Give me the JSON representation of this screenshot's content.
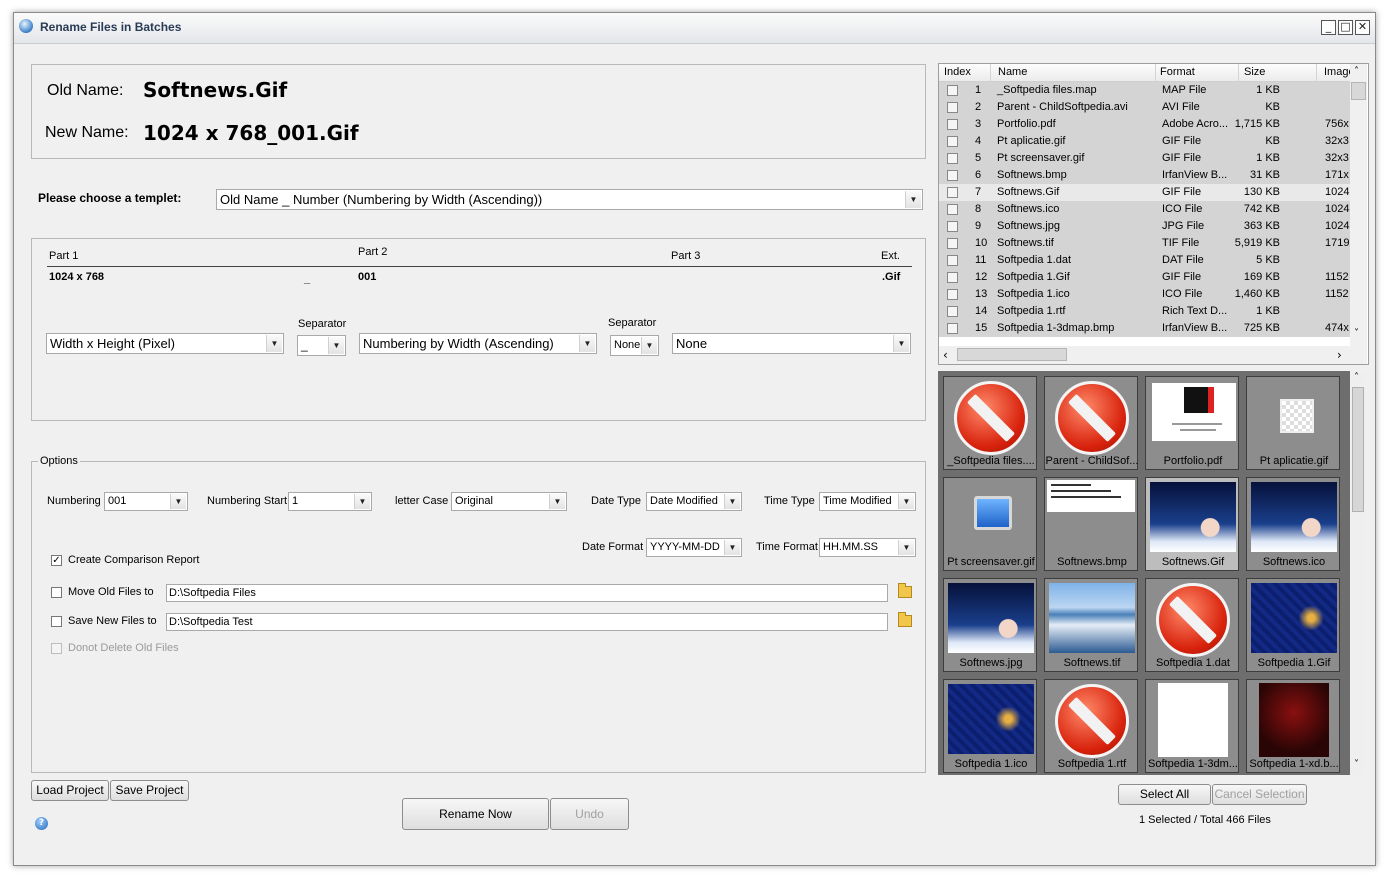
{
  "window": {
    "title": "Rename Files in Batches",
    "minimize": "_",
    "maximize": "□",
    "close": "✕"
  },
  "names": {
    "old_label": "Old Name:",
    "old_value": "Softnews.Gif",
    "new_label": "New Name:",
    "new_value": "1024 x 768_001.Gif"
  },
  "template": {
    "label": "Please choose a templet:",
    "value": "Old Name _ Number (Numbering by Width (Ascending))"
  },
  "parts": {
    "part1_label": "Part 1",
    "part2_label": "Part 2",
    "part3_label": "Part 3",
    "ext_label": "Ext.",
    "part1_value": "1024 x 768",
    "sep1_value": "_",
    "part2_value": "001",
    "ext_value": ".Gif",
    "separator_label_1": "Separator",
    "separator_label_2": "Separator",
    "combo1": "Width x Height (Pixel)",
    "combo_sep1": "_",
    "combo2": "Numbering by Width (Ascending)",
    "combo_sep2": "None",
    "combo3": "None"
  },
  "options": {
    "title": "Options",
    "numbering_label": "Numbering",
    "numbering_value": "001",
    "numbering_start_label": "Numbering Start",
    "numbering_start_value": "1",
    "letter_case_label": "letter Case",
    "letter_case_value": "Original",
    "date_type_label": "Date Type",
    "date_type_value": "Date Modified",
    "time_type_label": "Time Type",
    "time_type_value": "Time Modified",
    "date_format_label": "Date Format",
    "date_format_value": "YYYY-MM-DD",
    "time_format_label": "Time Format",
    "time_format_value": "HH.MM.SS",
    "create_report_label": "Create Comparison Report",
    "create_report_checked": true,
    "move_old_label": "Move Old Files to",
    "move_old_path": "D:\\Softpedia Files",
    "save_new_label": "Save New Files to",
    "save_new_path": "D:\\Softpedia Test",
    "donot_delete_label": "Donot Delete Old Files"
  },
  "buttons": {
    "load_project": "Load Project",
    "save_project": "Save Project",
    "rename_now": "Rename Now",
    "undo": "Undo",
    "select_all": "Select All",
    "cancel_selection": "Cancel Selection"
  },
  "status": "1 Selected / Total 466 Files",
  "filelist": {
    "columns": [
      "Index",
      "Name",
      "Format",
      "Size",
      "Image"
    ],
    "rows": [
      {
        "index": "1",
        "name": "_Softpedia files.map",
        "format": "MAP File",
        "size": "1 KB",
        "image": ""
      },
      {
        "index": "2",
        "name": "Parent - ChildSoftpedia.avi",
        "format": "AVI File",
        "size": "KB",
        "image": ""
      },
      {
        "index": "3",
        "name": "Portfolio.pdf",
        "format": "Adobe Acro...",
        "size": "1,715 KB",
        "image": "756x"
      },
      {
        "index": "4",
        "name": "Pt aplicatie.gif",
        "format": "GIF File",
        "size": "KB",
        "image": "32x3"
      },
      {
        "index": "5",
        "name": "Pt screensaver.gif",
        "format": "GIF File",
        "size": "1 KB",
        "image": "32x3"
      },
      {
        "index": "6",
        "name": "Softnews.bmp",
        "format": "IrfanView B...",
        "size": "31 KB",
        "image": "171x"
      },
      {
        "index": "7",
        "name": "Softnews.Gif",
        "format": "GIF File",
        "size": "130 KB",
        "image": "1024"
      },
      {
        "index": "8",
        "name": "Softnews.ico",
        "format": "ICO File",
        "size": "742 KB",
        "image": "1024"
      },
      {
        "index": "9",
        "name": "Softnews.jpg",
        "format": "JPG File",
        "size": "363 KB",
        "image": "1024"
      },
      {
        "index": "10",
        "name": "Softnews.tif",
        "format": "TIF File",
        "size": "5,919 KB",
        "image": "1719"
      },
      {
        "index": "11",
        "name": "Softpedia 1.dat",
        "format": "DAT File",
        "size": "5 KB",
        "image": ""
      },
      {
        "index": "12",
        "name": "Softpedia 1.Gif",
        "format": "GIF File",
        "size": "169 KB",
        "image": "1152"
      },
      {
        "index": "13",
        "name": "Softpedia 1.ico",
        "format": "ICO File",
        "size": "1,460 KB",
        "image": "1152"
      },
      {
        "index": "14",
        "name": "Softpedia 1.rtf",
        "format": "Rich Text D...",
        "size": "1 KB",
        "image": ""
      },
      {
        "index": "15",
        "name": "Softpedia 1-3dmap.bmp",
        "format": "IrfanView B...",
        "size": "725 KB",
        "image": "474x"
      }
    ]
  },
  "thumbnails": [
    {
      "caption": "_Softpedia files....",
      "kind": "no-entry-icon"
    },
    {
      "caption": "Parent - ChildSof...",
      "kind": "no-entry-icon"
    },
    {
      "caption": "Portfolio.pdf",
      "kind": "pdf-page"
    },
    {
      "caption": "Pt aplicatie.gif",
      "kind": "small-gif"
    },
    {
      "caption": "Pt screensaver.gif",
      "kind": "monitor-icon"
    },
    {
      "caption": "Softnews.bmp",
      "kind": "text-bmp"
    },
    {
      "caption": "Softnews.Gif",
      "kind": "blue-photo"
    },
    {
      "caption": "Softnews.ico",
      "kind": "blue-photo"
    },
    {
      "caption": "Softnews.jpg",
      "kind": "blue-photo"
    },
    {
      "caption": "Softnews.tif",
      "kind": "landscape"
    },
    {
      "caption": "Softpedia 1.dat",
      "kind": "no-entry-icon"
    },
    {
      "caption": "Softpedia 1.Gif",
      "kind": "blue-swirl"
    },
    {
      "caption": "Softpedia 1.ico",
      "kind": "blue-swirl"
    },
    {
      "caption": "Softpedia 1.rtf",
      "kind": "no-entry-icon"
    },
    {
      "caption": "Softpedia 1-3dm...",
      "kind": "white-page"
    },
    {
      "caption": "Softpedia 1-xd.b...",
      "kind": "red-dark"
    }
  ],
  "help_icon": "?"
}
